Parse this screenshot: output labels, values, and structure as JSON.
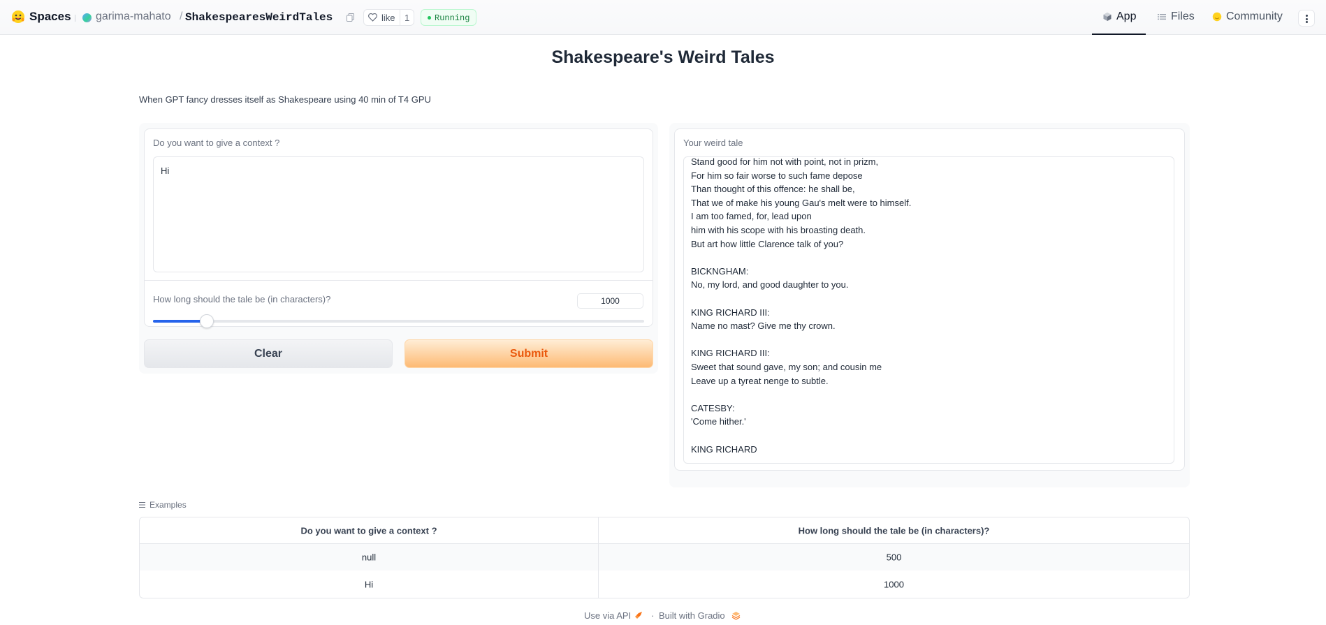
{
  "nav": {
    "brand": "Spaces",
    "owner": "garima-mahato",
    "separator": "/",
    "repo": "ShakespearesWeirdTales",
    "like_label": "like",
    "like_count": "1",
    "status": "Running",
    "status_color": "#15803d",
    "tabs": [
      {
        "label": "App",
        "icon": "app-cube-icon",
        "active": true
      },
      {
        "label": "Files",
        "icon": "files-icon",
        "active": false
      },
      {
        "label": "Community",
        "icon": "community-icon",
        "active": false
      }
    ]
  },
  "page": {
    "title": "Shakespeare's Weird Tales",
    "description": "When GPT fancy dresses itself as Shakespeare using 40 min of T4 GPU"
  },
  "inputs": {
    "context_label": "Do you want to give a context ?",
    "context_value": "Hi",
    "length_label": "How long should the tale be (in characters)?",
    "length_value": "1000",
    "slider_fraction": 0.11,
    "accent_color": "#2563eb"
  },
  "buttons": {
    "clear": "Clear",
    "submit": "Submit",
    "submit_color": "#ea580c"
  },
  "output": {
    "label": "Your weird tale",
    "lines": [
      "Stand good for him not with point, not in prizm,",
      "For him so fair worse to such fame depose",
      "Than thought of this offence: he shall be,",
      "That we of make his young Gau's melt were to himself.",
      "I am too famed, for, lead upon",
      "him with his scope with his broasting death.",
      "But art how little Clarence talk of you?",
      "",
      "BICKNGHAM:",
      "No, my lord, and good daughter to you.",
      "",
      "KING RICHARD III:",
      "Name no mast? Give me thy crown.",
      "",
      "KING RICHARD III:",
      "Sweet that sound gave, my son; and cousin me",
      "Leave up a tyreat nenge to subtle.",
      "",
      "CATESBY:",
      "'Come hither.'",
      "",
      "KING RICHARD"
    ]
  },
  "examples": {
    "label": "Examples",
    "headers": [
      "Do you want to give a context ?",
      "How long should the tale be (in characters)?"
    ],
    "rows": [
      [
        "null",
        "500"
      ],
      [
        "Hi",
        "1000"
      ]
    ]
  },
  "footer": {
    "api": "Use via API",
    "dot": "·",
    "built": "Built with Gradio"
  }
}
